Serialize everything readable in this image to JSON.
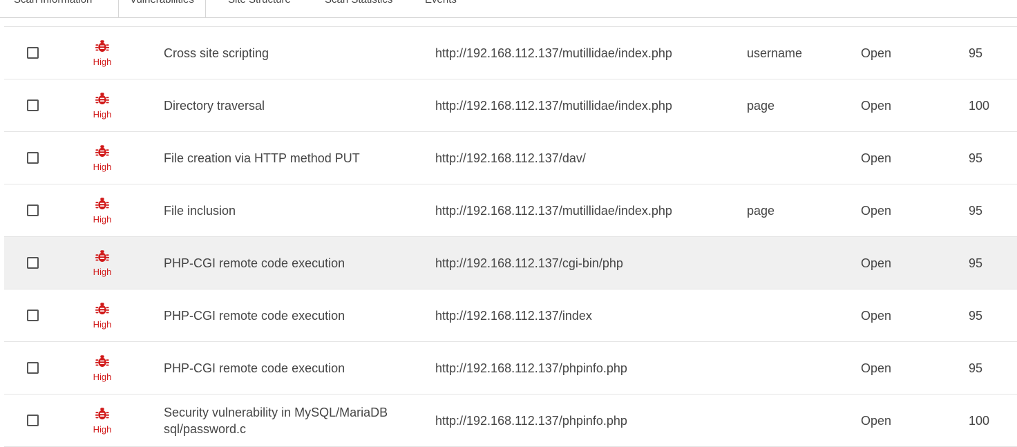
{
  "tabs": [
    {
      "label": "Scan Information",
      "active": false
    },
    {
      "label": "Vulnerabilities",
      "active": true
    },
    {
      "label": "Site Structure",
      "active": false
    },
    {
      "label": "Scan Statistics",
      "active": false
    },
    {
      "label": "Events",
      "active": false
    }
  ],
  "colors": {
    "severity_high": "#d11a1a",
    "row_hover": "#f0f0f0"
  },
  "rows": [
    {
      "severity": "High",
      "name": "Cross site scripting",
      "url": "http://192.168.112.137/mutillidae/index.php",
      "parameter": "username",
      "status": "Open",
      "confidence": "95"
    },
    {
      "severity": "High",
      "name": "Directory traversal",
      "url": "http://192.168.112.137/mutillidae/index.php",
      "parameter": "page",
      "status": "Open",
      "confidence": "100"
    },
    {
      "severity": "High",
      "name": "File creation via HTTP method PUT",
      "url": "http://192.168.112.137/dav/",
      "parameter": "",
      "status": "Open",
      "confidence": "95"
    },
    {
      "severity": "High",
      "name": "File inclusion",
      "url": "http://192.168.112.137/mutillidae/index.php",
      "parameter": "page",
      "status": "Open",
      "confidence": "95"
    },
    {
      "severity": "High",
      "name": "PHP-CGI remote code execution",
      "url": "http://192.168.112.137/cgi-bin/php",
      "parameter": "",
      "status": "Open",
      "confidence": "95"
    },
    {
      "severity": "High",
      "name": "PHP-CGI remote code execution",
      "url": "http://192.168.112.137/index",
      "parameter": "",
      "status": "Open",
      "confidence": "95"
    },
    {
      "severity": "High",
      "name": "PHP-CGI remote code execution",
      "url": "http://192.168.112.137/phpinfo.php",
      "parameter": "",
      "status": "Open",
      "confidence": "95"
    },
    {
      "severity": "High",
      "name": "Security vulnerability in MySQL/MariaDB sql/password.c",
      "url": "http://192.168.112.137/phpinfo.php",
      "parameter": "",
      "status": "Open",
      "confidence": "100"
    }
  ]
}
